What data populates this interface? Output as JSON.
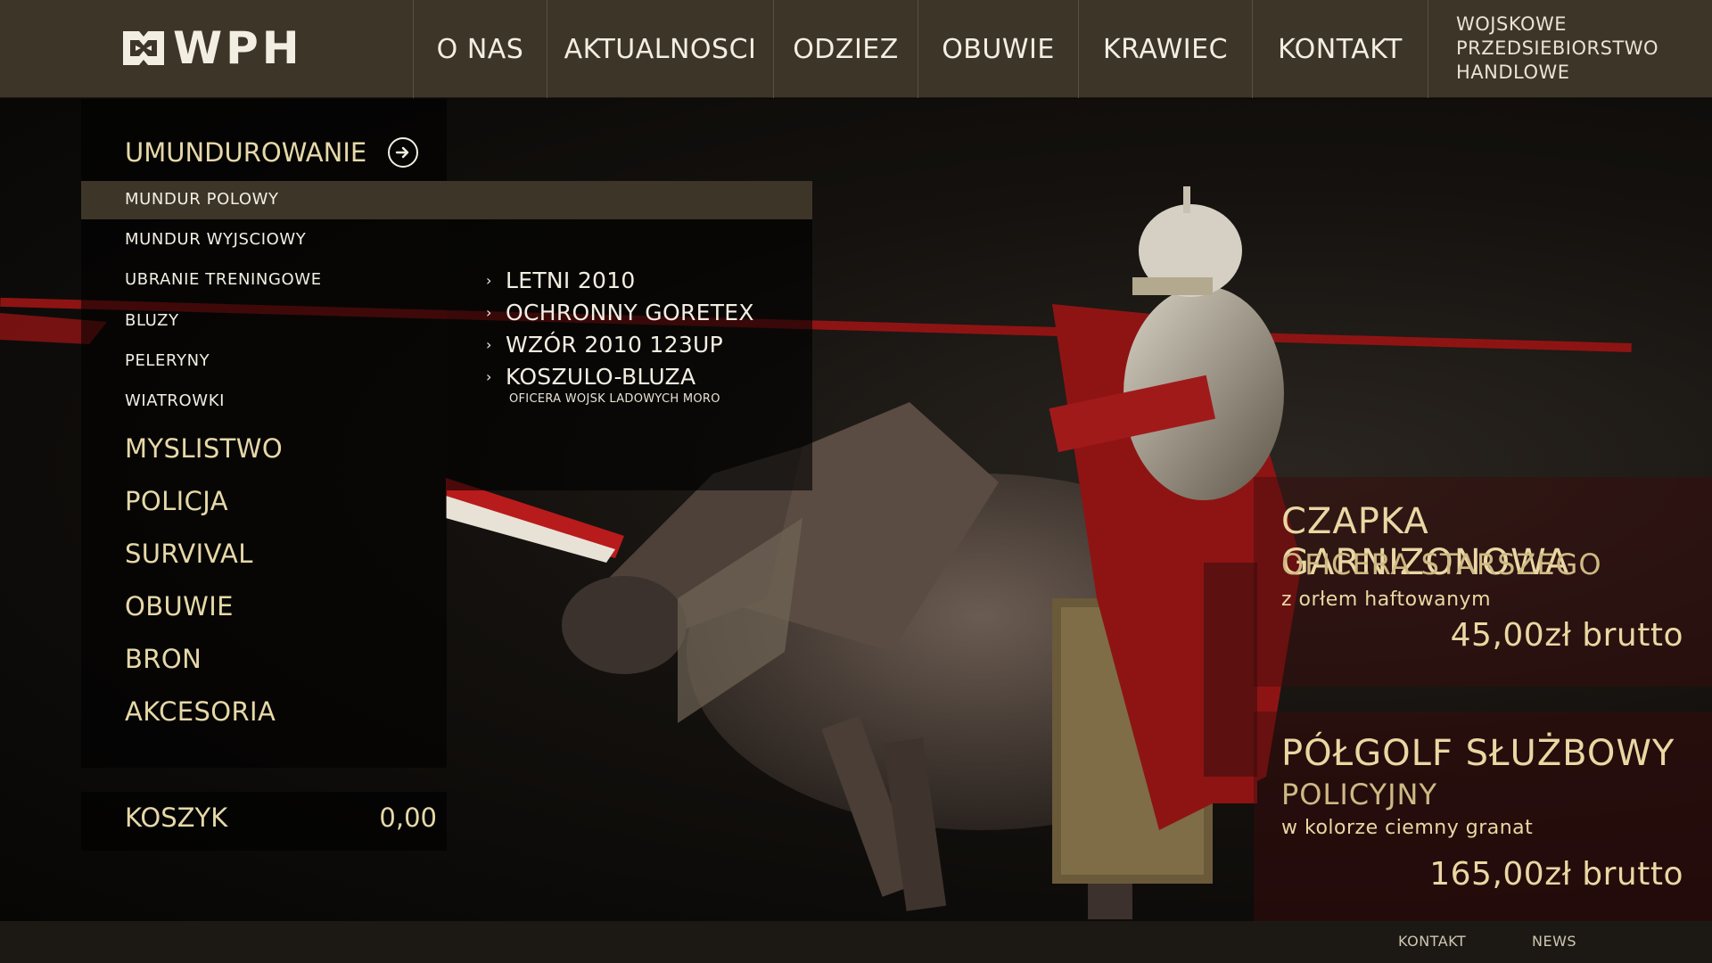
{
  "header": {
    "logo_text": "WPH",
    "nav": [
      "O NAS",
      "AKTUALNOSCI",
      "ODZIEZ",
      "OBUWIE",
      "KRAWIEC",
      "KONTAKT"
    ],
    "tagline": [
      "WOJSKOWE",
      "PRZEDSIEBIORSTWO",
      "HANDLOWE"
    ]
  },
  "menu": {
    "heading": "UMUNDUROWANIE",
    "heading_icon": "arrow-right-circle-icon",
    "subitems": [
      "MUNDUR POLOWY",
      "MUNDUR WYJSCIOWY",
      "UBRANIE TRENINGOWE",
      "BLUZY",
      "PELERYNY",
      "WIATROWKI"
    ],
    "active_subitem": "MUNDUR POLOWY",
    "categories": [
      "MYSLISTWO",
      "POLICJA",
      "SURVIVAL",
      "OBUWIE",
      "BRON",
      "AKCESORIA"
    ]
  },
  "flyout": {
    "items": [
      "LETNI 2010",
      "OCHRONNY GORETEX",
      "WZÓR 2010 123UP",
      "KOSZULO-BLUZA"
    ],
    "note": "OFICERA WOJSK LADOWYCH MORO"
  },
  "cart": {
    "label": "KOSZYK",
    "value": "0,00"
  },
  "promos": [
    {
      "title": "CZAPKA GARNIZONOWA",
      "subtitle": "OFICERA STARSZEGO",
      "desc": "z orłem haftowanym",
      "price": "45,00zł brutto"
    },
    {
      "title": "PÓŁGOLF SŁUŻBOWY",
      "subtitle": "POLICYJNY",
      "desc": "w kolorze ciemny granat",
      "price": "165,00zł brutto"
    }
  ],
  "footer": {
    "links": [
      "KONTAKT",
      "NEWS"
    ]
  },
  "colors": {
    "header_bg": "#3d3528",
    "accent_gold": "#e6d8a8",
    "promo_red": "#3c0a0a"
  }
}
